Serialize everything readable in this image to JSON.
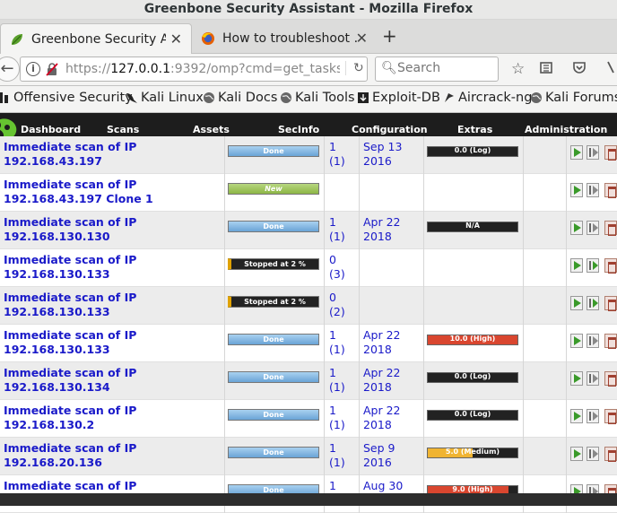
{
  "window": {
    "title": "Greenbone Security Assistant - Mozilla Firefox"
  },
  "tabs": [
    {
      "label": "Greenbone Security A…",
      "icon": "gsa-leaf-icon",
      "active": true
    },
    {
      "label": "How to troubleshoot …",
      "icon": "firefox-icon",
      "active": false
    }
  ],
  "navbar": {
    "url_prefix": "https://",
    "url_host": "127.0.0.1",
    "url_rest": ":9392/omp?cmd=get_tasks",
    "search_placeholder": "Search"
  },
  "bookmarks": [
    {
      "label": "Offensive Security",
      "icon": "offsec-icon"
    },
    {
      "label": "Kali Linux",
      "icon": "kali-dragon-icon"
    },
    {
      "label": "Kali Docs",
      "icon": "globe-icon"
    },
    {
      "label": "Kali Tools",
      "icon": "globe-icon"
    },
    {
      "label": "Exploit-DB",
      "icon": "exploitdb-icon"
    },
    {
      "label": "Aircrack-ng",
      "icon": "aircrack-icon"
    },
    {
      "label": "Kali Forums",
      "icon": "globe-icon"
    }
  ],
  "gsa_menu": [
    "Dashboard",
    "Scans",
    "Assets",
    "SecInfo",
    "Configuration",
    "Extras",
    "Administration"
  ],
  "tasks": [
    {
      "name1": "Immediate scan of IP",
      "name2": "192.168.43.197",
      "status": "Done",
      "status_type": "done",
      "reports": "1",
      "reports_sub": "(1)",
      "date1": "Sep 13",
      "date2": "2016",
      "severity": "0.0 (Log)",
      "severity_fraction": 0.0,
      "severity_color": "#222222",
      "resume_green": false
    },
    {
      "name1": "Immediate scan of IP",
      "name2": "192.168.43.197 Clone 1",
      "status": "New",
      "status_type": "new",
      "reports": "",
      "reports_sub": "",
      "date1": "",
      "date2": "",
      "severity": "",
      "severity_fraction": null,
      "severity_color": "",
      "resume_green": false
    },
    {
      "name1": "Immediate scan of IP",
      "name2": "192.168.130.130",
      "status": "Done",
      "status_type": "done",
      "reports": "1",
      "reports_sub": "(1)",
      "date1": "Apr 22",
      "date2": "2018",
      "severity": "N/A",
      "severity_fraction": 0.0,
      "severity_color": "#222222",
      "resume_green": false
    },
    {
      "name1": "Immediate scan of IP",
      "name2": "192.168.130.133",
      "status": "Stopped at 2 %",
      "status_type": "stopped",
      "reports": "0",
      "reports_sub": "(3)",
      "date1": "",
      "date2": "",
      "severity": "",
      "severity_fraction": null,
      "severity_color": "",
      "resume_green": true
    },
    {
      "name1": "Immediate scan of IP",
      "name2": "192.168.130.133",
      "status": "Stopped at 2 %",
      "status_type": "stopped",
      "reports": "0",
      "reports_sub": "(2)",
      "date1": "",
      "date2": "",
      "severity": "",
      "severity_fraction": null,
      "severity_color": "",
      "resume_green": true
    },
    {
      "name1": "Immediate scan of IP",
      "name2": "192.168.130.133",
      "status": "Done",
      "status_type": "done",
      "reports": "1",
      "reports_sub": "(1)",
      "date1": "Apr 22",
      "date2": "2018",
      "severity": "10.0 (High)",
      "severity_fraction": 1.0,
      "severity_color": "#d9462f",
      "resume_green": false
    },
    {
      "name1": "Immediate scan of IP",
      "name2": "192.168.130.134",
      "status": "Done",
      "status_type": "done",
      "reports": "1",
      "reports_sub": "(1)",
      "date1": "Apr 22",
      "date2": "2018",
      "severity": "0.0 (Log)",
      "severity_fraction": 0.0,
      "severity_color": "#222222",
      "resume_green": false
    },
    {
      "name1": "Immediate scan of IP",
      "name2": "192.168.130.2",
      "status": "Done",
      "status_type": "done",
      "reports": "1",
      "reports_sub": "(1)",
      "date1": "Apr 22",
      "date2": "2018",
      "severity": "0.0 (Log)",
      "severity_fraction": 0.0,
      "severity_color": "#222222",
      "resume_green": false
    },
    {
      "name1": "Immediate scan of IP",
      "name2": "192.168.20.136",
      "status": "Done",
      "status_type": "done",
      "reports": "1",
      "reports_sub": "(1)",
      "date1": "Sep 9",
      "date2": "2016",
      "severity": "5.0 (Medium)",
      "severity_fraction": 0.5,
      "severity_color": "#f0b432",
      "resume_green": false
    },
    {
      "name1": "Immediate scan of IP",
      "name2": "",
      "status": "Done",
      "status_type": "done",
      "reports": "1",
      "reports_sub": "",
      "date1": "Aug 30",
      "date2": "",
      "severity": "9.0 (High)",
      "severity_fraction": 0.9,
      "severity_color": "#d9462f",
      "resume_green": false
    }
  ]
}
